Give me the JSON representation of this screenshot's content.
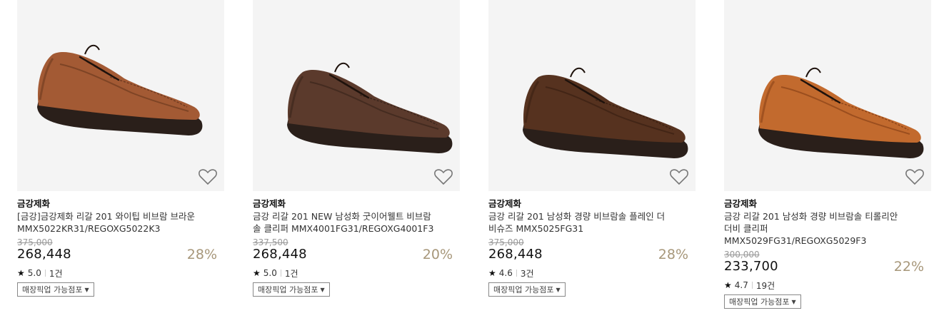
{
  "products": [
    {
      "brand": "금강제화",
      "name_line1": "[금강]금강제화 리갈 201 와이팁 비브람 브라운",
      "name_line2": "MMX5022KR31/REGOXG5022K3",
      "name_line3": "",
      "original_price": "375,000",
      "price": "268,448",
      "discount": "28%",
      "rating": "5.0",
      "reviews": "1건",
      "pickup_label": "매장픽업 가능점포",
      "shoe_color": "#a35a34",
      "shoe_dark": "#6e3a20"
    },
    {
      "brand": "금강제화",
      "name_line1": "금강 리갈 201 NEW 남성화 굿이어웰트 비브람",
      "name_line2": "솔 클리퍼 MMX4001FG31/REGOXG4001F3",
      "name_line3": "",
      "original_price": "337,500",
      "price": "268,448",
      "discount": "20%",
      "rating": "5.0",
      "reviews": "1건",
      "pickup_label": "매장픽업 가능점포",
      "shoe_color": "#5b3a2c",
      "shoe_dark": "#3a251b"
    },
    {
      "brand": "금강제화",
      "name_line1": "금강 리갈 201 남성화 경량 비브람솔 플레인 더",
      "name_line2": "비슈즈 MMX5025FG31",
      "name_line3": "",
      "original_price": "375,000",
      "price": "268,448",
      "discount": "28%",
      "rating": "4.6",
      "reviews": "3건",
      "pickup_label": "매장픽업 가능점포",
      "shoe_color": "#56321f",
      "shoe_dark": "#3a2012"
    },
    {
      "brand": "금강제화",
      "name_line1": "금강 리갈 201 남성화 경량 비브람솔 티롤리안",
      "name_line2": "더비 클리퍼",
      "name_line3": "MMX5029FG31/REGOXG5029F3",
      "original_price": "300,000",
      "price": "233,700",
      "discount": "22%",
      "rating": "4.7",
      "reviews": "19건",
      "pickup_label": "매장픽업 가능점포",
      "shoe_color": "#c26a2e",
      "shoe_dark": "#8a4318"
    }
  ]
}
